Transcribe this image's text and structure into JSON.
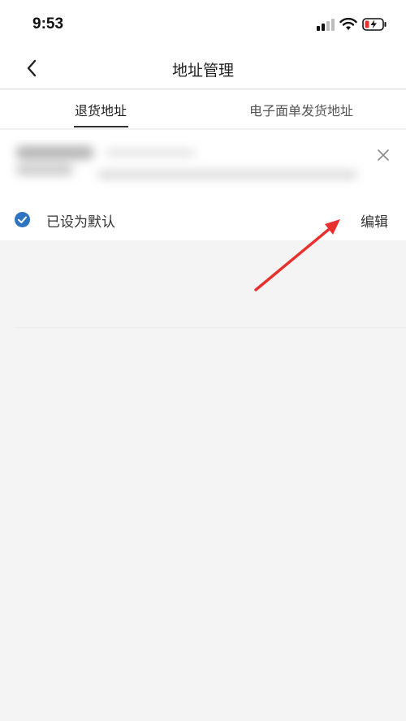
{
  "status_bar": {
    "time": "9:53",
    "signal_icon": "cellular-signal-icon",
    "wifi_icon": "wifi-icon",
    "battery_icon": "battery-charging-icon"
  },
  "nav": {
    "title": "地址管理",
    "back_icon": "chevron-left-icon"
  },
  "tabs": [
    {
      "label": "退货地址",
      "active": true
    },
    {
      "label": "电子面单发货地址",
      "active": false
    }
  ],
  "address_card": {
    "close_icon": "close-icon",
    "default_label": "已设为默认",
    "check_icon": "check-circle-icon",
    "edit_label": "编辑"
  },
  "colors": {
    "accent_blue": "#2f74c0",
    "annotation_red": "#e8312f",
    "background": "#f4f4f4"
  }
}
